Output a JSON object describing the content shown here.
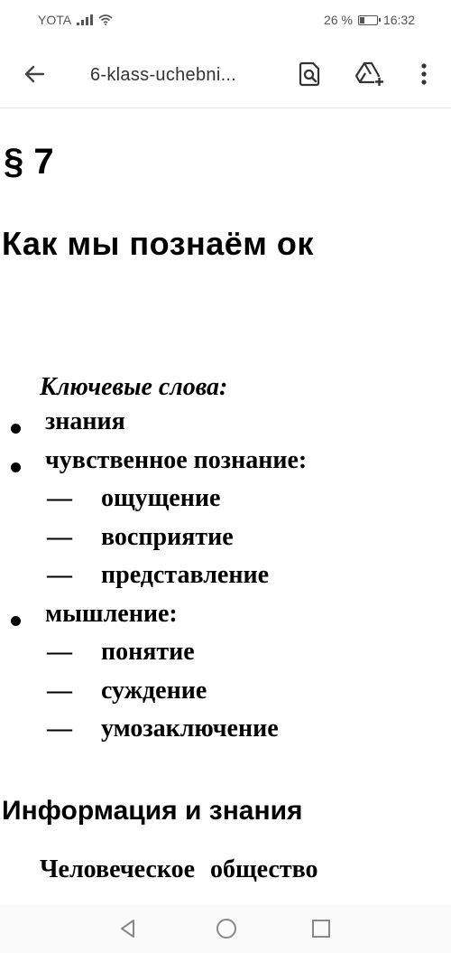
{
  "status_bar": {
    "carrier": "YOTA",
    "battery_percent": "26 %",
    "battery_level": 0.26,
    "time": "16:32"
  },
  "app_bar": {
    "title": "6-klass-uchebni...",
    "icons": [
      "back-arrow-icon",
      "search-document-icon",
      "add-to-drive-icon",
      "more-vert-icon"
    ]
  },
  "document": {
    "paragraph_number": "§ 7",
    "chapter_title": "Как мы познаём ок",
    "keywords_heading": "Ключевые слова:",
    "keywords": [
      {
        "text": "знания",
        "level": 1
      },
      {
        "text": "чувственное познание:",
        "level": 1
      },
      {
        "text": "ощущение",
        "level": 2
      },
      {
        "text": "восприятие",
        "level": 2
      },
      {
        "text": "представление",
        "level": 2
      },
      {
        "text": "мышление:",
        "level": 1
      },
      {
        "text": "понятие",
        "level": 2
      },
      {
        "text": "суждение",
        "level": 2
      },
      {
        "text": "умозаключение",
        "level": 2
      }
    ],
    "dash": "—",
    "section_title": "Информация и знания",
    "body_start": "Человеческое общество"
  },
  "nav_bar": {
    "icons": [
      "back-triangle-icon",
      "home-circle-icon",
      "recents-square-icon"
    ]
  }
}
